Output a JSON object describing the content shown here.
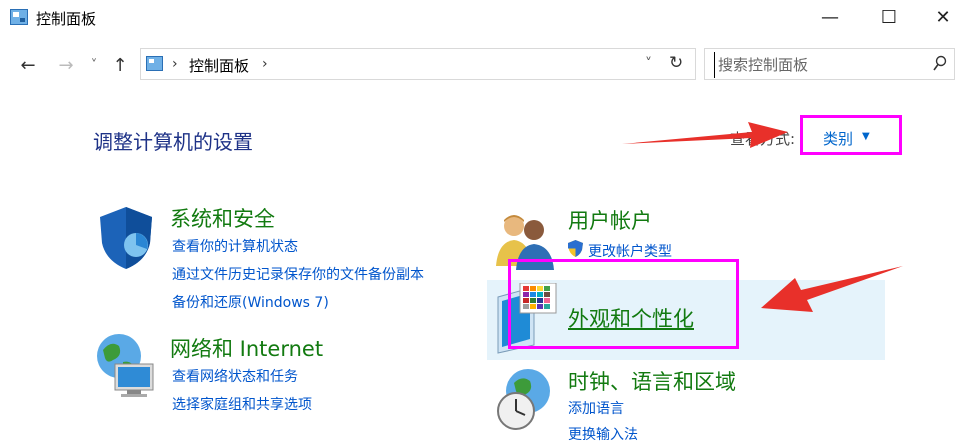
{
  "window": {
    "title": "控制面板",
    "minimize": "—",
    "maximize": "☐",
    "close": "✕"
  },
  "address": {
    "back": "←",
    "forward": "→",
    "recent": "˅",
    "up": "↑",
    "sep1": "›",
    "crumb": "控制面板",
    "sep2": "›",
    "dropdown": "˅",
    "refresh": "↻",
    "search_placeholder": "搜索控制面板"
  },
  "header": {
    "title": "调整计算机的设置",
    "view_by_label": "查看方式:",
    "view_by_value": "类别",
    "view_caret": "▼"
  },
  "categories": {
    "security": {
      "title": "系统和安全",
      "links": [
        "查看你的计算机状态",
        "通过文件历史记录保存你的文件备份副本",
        "备份和还原(Windows 7)"
      ]
    },
    "network": {
      "title": "网络和 Internet",
      "links": [
        "查看网络状态和任务",
        "选择家庭组和共享选项"
      ]
    },
    "users": {
      "title": "用户帐户",
      "links": [
        "更改帐户类型"
      ]
    },
    "appearance": {
      "title": "外观和个性化"
    },
    "clock": {
      "title": "时钟、语言和区域",
      "links": [
        "添加语言",
        "更换输入法"
      ]
    }
  },
  "colors": {
    "highlight": "#ff00ff",
    "arrow": "#e8302a",
    "category": "#127a10",
    "link": "#0055cc",
    "heading": "#1e3287"
  },
  "icons": [
    "control-panel-icon",
    "shield-icon",
    "network-globe-icon",
    "users-icon",
    "appearance-icon",
    "clock-globe-icon",
    "search-icon",
    "uac-shield-icon"
  ]
}
